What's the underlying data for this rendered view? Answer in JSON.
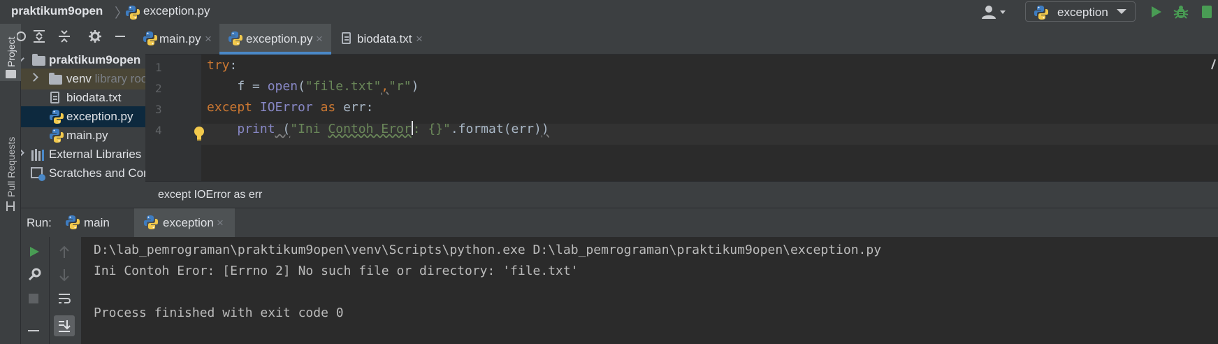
{
  "nav": {
    "project": "praktikum9open",
    "separator": "〉",
    "file": "exception.py",
    "run_config": "exception"
  },
  "left_stripe": {
    "project": "Project",
    "pull_requests": "Pull Requests"
  },
  "project_tree": [
    {
      "label": "praktikum9open",
      "kind": "root-folder"
    },
    {
      "label": "venv",
      "hint": "library root",
      "kind": "folder"
    },
    {
      "label": "biodata.txt",
      "kind": "text-file"
    },
    {
      "label": "exception.py",
      "kind": "python-file",
      "selected": true
    },
    {
      "label": "main.py",
      "kind": "python-file"
    },
    {
      "label": "External Libraries",
      "kind": "libraries"
    },
    {
      "label": "Scratches and Consoles",
      "kind": "scratches"
    }
  ],
  "editor_tabs": [
    {
      "label": "main.py",
      "icon": "python-icon"
    },
    {
      "label": "exception.py",
      "icon": "python-icon",
      "active": true
    },
    {
      "label": "biodata.txt",
      "icon": "text-file-icon"
    }
  ],
  "close_glyph": "×",
  "editor": {
    "line_numbers": [
      "1",
      "2",
      "3",
      "4"
    ],
    "l1_kw": "try",
    "colon": ":",
    "l2_indent": "    f = ",
    "l2_fn": "open",
    "l2_open": "(",
    "l2_str1": "\"file.txt\"",
    "l2_comma": ",",
    "l2_str2": "\"r\"",
    "l2_close": ")",
    "l3_except": "except",
    "l3_err_type": " IOError ",
    "l3_as": "as",
    "l3_rest": " err:",
    "l4_indent": "    ",
    "l4_fn": "print",
    "l4_open": " (",
    "l4_str_a": "\"Ini ",
    "l4_str_b": "Contoh Eror",
    "l4_str_c": ": {}\"",
    "l4_rest": ".format(err)",
    "l4_close": ")"
  },
  "breadcrumb": "except IOError as err",
  "run": {
    "label": "Run:",
    "tabs": [
      {
        "label": "main",
        "icon": "python-icon"
      },
      {
        "label": "exception",
        "icon": "python-icon",
        "active": true
      }
    ]
  },
  "console_lines": [
    "D:\\lab_pemrograman\\praktikum9open\\venv\\Scripts\\python.exe D:\\lab_pemrograman\\praktikum9open\\exception.py",
    "Ini Contoh Eror: [Errno 2] No such file or directory: 'file.txt'",
    "",
    "Process finished with exit code 0"
  ],
  "colors": {
    "background": "#2b2b2b",
    "panel": "#3c3f41",
    "keyword": "#cc7832",
    "builtin": "#8888c6",
    "string": "#6a8759",
    "accent": "#4a88c7",
    "run_green": "#499c54"
  }
}
